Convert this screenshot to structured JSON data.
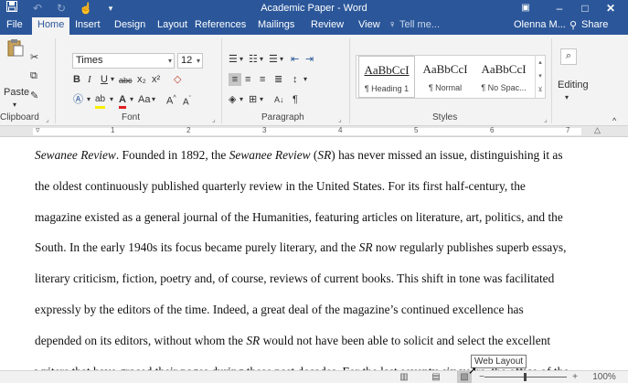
{
  "titlebar": {
    "title": "Academic Paper - Word",
    "icons": [
      "save-icon",
      "undo-icon",
      "redo-icon",
      "touch-mode-icon",
      "customize-qat-icon",
      "ribbon-display-icon",
      "minimize-icon",
      "maximize-icon",
      "close-icon"
    ]
  },
  "tabs": {
    "file": "File",
    "home": "Home",
    "insert": "Insert",
    "design": "Design",
    "layout": "Layout",
    "references": "References",
    "mailings": "Mailings",
    "review": "Review",
    "view": "View",
    "tellme": "Tell me...",
    "user": "Olenna M...",
    "share": "Share"
  },
  "ribbon": {
    "clipboard": {
      "label": "Clipboard",
      "paste": "Paste"
    },
    "font": {
      "label": "Font",
      "name": "Times",
      "size": "12"
    },
    "paragraph": {
      "label": "Paragraph"
    },
    "styles": {
      "label": "Styles",
      "items": [
        {
          "preview": "AaBbCcI",
          "name": "¶ Heading 1"
        },
        {
          "preview": "AaBbCcI",
          "name": "¶ Normal"
        },
        {
          "preview": "AaBbCcI",
          "name": "¶ No Spac..."
        }
      ]
    },
    "editing": {
      "label": "Editing"
    }
  },
  "ruler": {
    "numbers": [
      "1",
      "2",
      "3",
      "4",
      "5",
      "6",
      "7"
    ]
  },
  "document": {
    "lines": [
      [
        {
          "t": "Sewanee Review",
          "i": true
        },
        {
          "t": ". Founded in 1892, the "
        },
        {
          "t": "Sewanee Review",
          "i": true
        },
        {
          "t": " ("
        },
        {
          "t": "SR",
          "i": true
        },
        {
          "t": ") has never missed an issue, distinguishing it as"
        }
      ],
      [
        {
          "t": "the oldest continuously published quarterly review in the United States. For its first half-century, the"
        }
      ],
      [
        {
          "t": "magazine existed as a general journal of the Humanities, featuring articles on literature, art, politics, and the"
        }
      ],
      [
        {
          "t": "South. In the early 1940s its focus became purely literary, and the "
        },
        {
          "t": "SR",
          "i": true
        },
        {
          "t": " now regularly publishes superb essays,"
        }
      ],
      [
        {
          "t": "literary criticism, fiction, poetry and, of course, reviews of current books. This shift in tone was facilitated"
        }
      ],
      [
        {
          "t": "expressly by the editors of the time. Indeed, a great deal of the magazine’s continued excellence has"
        }
      ],
      [
        {
          "t": "depended on its editors, without whom the "
        },
        {
          "t": "SR",
          "i": true
        },
        {
          "t": " would not have been able to solicit and select the excellent"
        }
      ],
      [
        {
          "t": "writers that have graced their pages during these past decades. For the last seventy-six years, the office of the"
        }
      ]
    ]
  },
  "statusbar": {
    "tooltip": "Web Layout",
    "zoom": "100%",
    "zoom_minus": "−",
    "zoom_plus": "+"
  }
}
